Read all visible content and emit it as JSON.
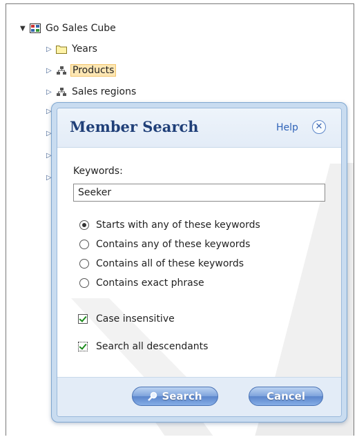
{
  "tree": {
    "root": {
      "label": "Go Sales Cube",
      "icon": "cube-icon"
    },
    "children": [
      {
        "label": "Years",
        "icon": "folder-icon"
      },
      {
        "label": "Products",
        "icon": "hierarchy-icon",
        "selected": true
      },
      {
        "label": "Sales regions",
        "icon": "hierarchy-icon"
      }
    ]
  },
  "dialog": {
    "title": "Member Search",
    "help_label": "Help",
    "close_symbol": "✕",
    "keywords_label": "Keywords:",
    "keywords_value": "Seeker",
    "options": [
      {
        "label": "Starts with any of these keywords",
        "selected": true
      },
      {
        "label": "Contains any of these keywords",
        "selected": false
      },
      {
        "label": "Contains all of these keywords",
        "selected": false
      },
      {
        "label": "Contains exact phrase",
        "selected": false
      }
    ],
    "case_insensitive_label": "Case insensitive",
    "case_insensitive_checked": true,
    "search_descendants_label": "Search all descendants",
    "search_descendants_checked": true,
    "search_button": "Search",
    "cancel_button": "Cancel"
  },
  "colors": {
    "title": "#1f3f78",
    "link": "#2f63b8",
    "selected_bg": "#fde7b4",
    "button": "#5b85cc",
    "check": "#1a8a1a"
  }
}
